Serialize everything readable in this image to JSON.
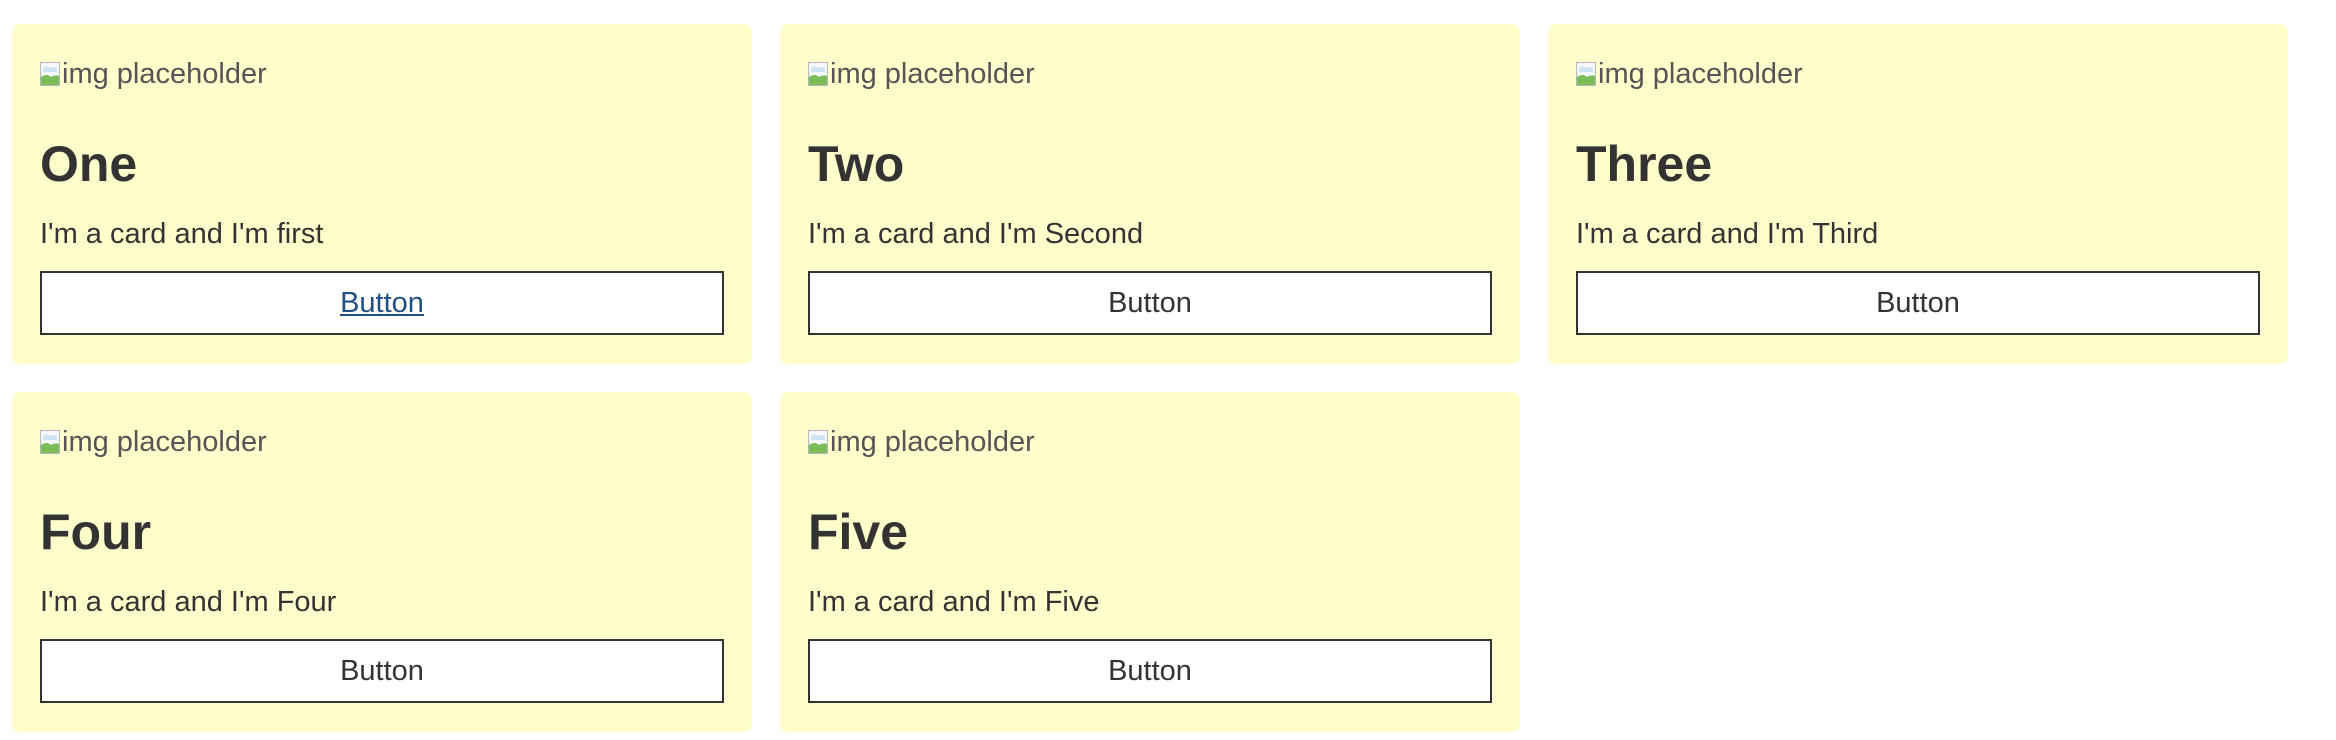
{
  "cards": [
    {
      "image_alt": "img placeholder",
      "title": "One",
      "text": "I'm a card and I'm first",
      "button_label": "Button"
    },
    {
      "image_alt": "img placeholder",
      "title": "Two",
      "text": "I'm a card and I'm Second",
      "button_label": "Button"
    },
    {
      "image_alt": "img placeholder",
      "title": "Three",
      "text": "I'm a card and I'm Third",
      "button_label": "Button"
    },
    {
      "image_alt": "img placeholder",
      "title": "Four",
      "text": "I'm a card and I'm Four",
      "button_label": "Button"
    },
    {
      "image_alt": "img placeholder",
      "title": "Five",
      "text": "I'm a card and I'm Five",
      "button_label": "Button"
    }
  ],
  "colors": {
    "card_background": "#ffffcc",
    "text": "#333333",
    "link": "#1e4f86",
    "button_background": "#ffffff"
  }
}
